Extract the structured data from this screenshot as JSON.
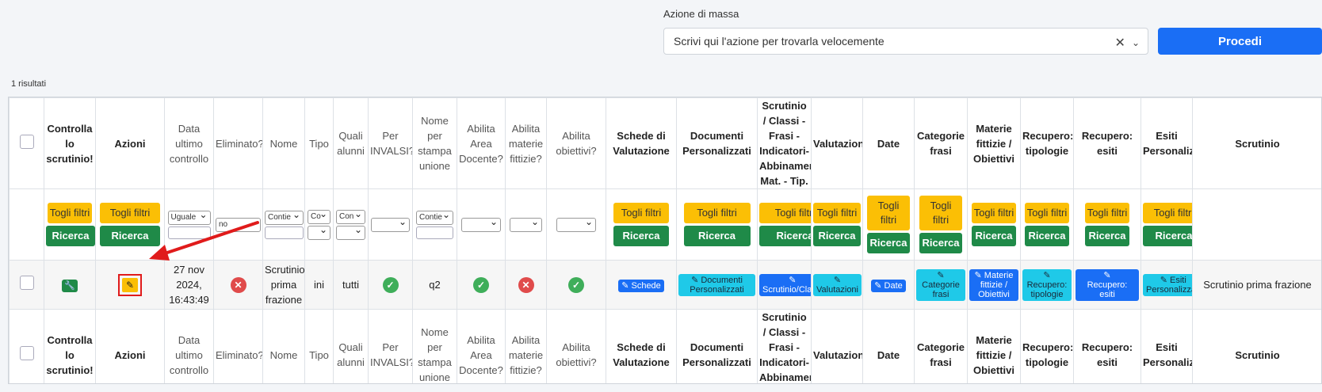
{
  "mass_action": {
    "label": "Azione di massa",
    "placeholder": "Scrivi qui l'azione per trovarla velocemente",
    "clear_icon": "close-icon",
    "dropdown_icon": "chevron-down-icon",
    "proceed_label": "Procedi"
  },
  "results_count": "1 risultati",
  "columns": [
    "Controlla lo scrutinio!",
    "Azioni",
    "Data ultimo controllo",
    "Eliminato?",
    "Nome",
    "Tipo",
    "Quali alunni",
    "Per INVALSI?",
    "Nome per stampa unione",
    "Abilita Area Docente?",
    "Abilita materie fittizie?",
    "Abilita obiettivi?",
    "Schede di Valutazione",
    "Documenti Personalizzati",
    "Scrutinio / Classi - Frasi - Indicatori-Abbinamenti Mat. - Tip.",
    "Valutazioni",
    "Date",
    "Categorie frasi",
    "Materie fittizie / Obiettivi",
    "Recupero: tipologie",
    "Recupero: esiti",
    "Esiti Personalizzati",
    "Scrutinio"
  ],
  "filters": {
    "clear_label": "Togli filtri",
    "search_label": "Ricerca",
    "data_ultimo_select": "Uguale",
    "eliminato_select": "no",
    "nome_select": "Contie",
    "tipo_select": "Co",
    "quali_select": "Con",
    "nome_stampa_select": "Contie"
  },
  "row": {
    "data_ultimo": "27 nov 2024, 16:43:49",
    "nome": "Scrutinio prima frazione",
    "tipo": "ini",
    "quali_alunni": "tutti",
    "nome_stampa": "q2",
    "btn_schede": "Schede",
    "btn_documenti": "Documenti Personalizzati",
    "btn_scrutinio": "Scrutinio/Classi",
    "btn_valutazioni": "Valutazioni",
    "btn_date": "Date",
    "btn_categorie": "Categorie frasi",
    "btn_materie": "Materie fittizie / Obiettivi",
    "btn_rec_tipologie": "Recupero: tipologie",
    "btn_rec_esiti": "Recupero: esiti",
    "btn_esiti": "Esiti Personalizzati",
    "scrutinio": "Scrutinio prima frazione"
  },
  "colors": {
    "primary_blue": "#1a6ef5",
    "yellow": "#fbbf05",
    "green": "#1f8a48",
    "cyan": "#1fc9e8",
    "annotation_red": "#e01b1b"
  }
}
